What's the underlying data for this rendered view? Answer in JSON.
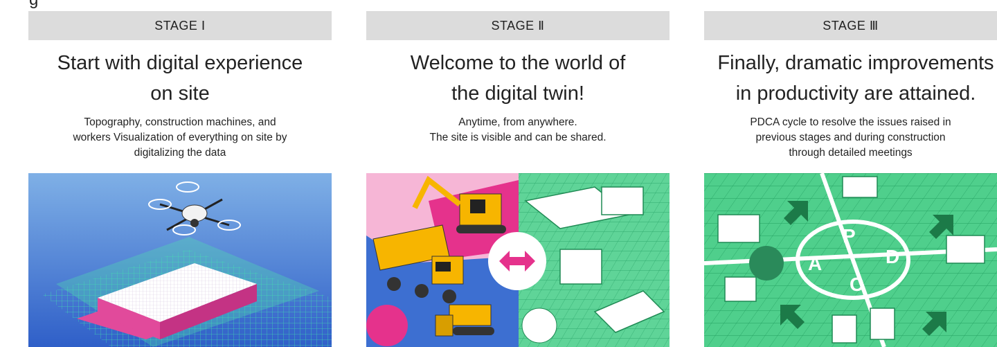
{
  "top_fragment": "g",
  "stages": [
    {
      "label": "STAGE Ⅰ",
      "title_line1": "Start with digital experience",
      "title_line2": "on site",
      "desc_lines": [
        "Topography, construction machines, and",
        "workers Visualization of everything on site by",
        "digitalizing the data"
      ],
      "illustration": "drone-survey-illustration"
    },
    {
      "label": "STAGE Ⅱ",
      "title_line1": "Welcome to the world of",
      "title_line2": "the digital twin!",
      "desc_lines": [
        "Anytime, from anywhere.",
        "The site is visible and can be shared."
      ],
      "illustration": "digital-twin-illustration"
    },
    {
      "label": "STAGE Ⅲ",
      "title_line1": "Finally, dramatic improvements",
      "title_line2": "in productivity are attained.",
      "desc_lines": [
        "PDCA cycle to resolve the issues raised in",
        "previous stages and during construction",
        "through detailed meetings"
      ],
      "pdca_letters": [
        "P",
        "D",
        "C",
        "A"
      ],
      "illustration": "pdca-cycle-illustration"
    }
  ],
  "colors": {
    "stage_bar": "#dcdcdc",
    "green": "#3cc47c",
    "magenta": "#e5328c",
    "blue": "#3d6fd1",
    "yellow": "#f7b500"
  }
}
